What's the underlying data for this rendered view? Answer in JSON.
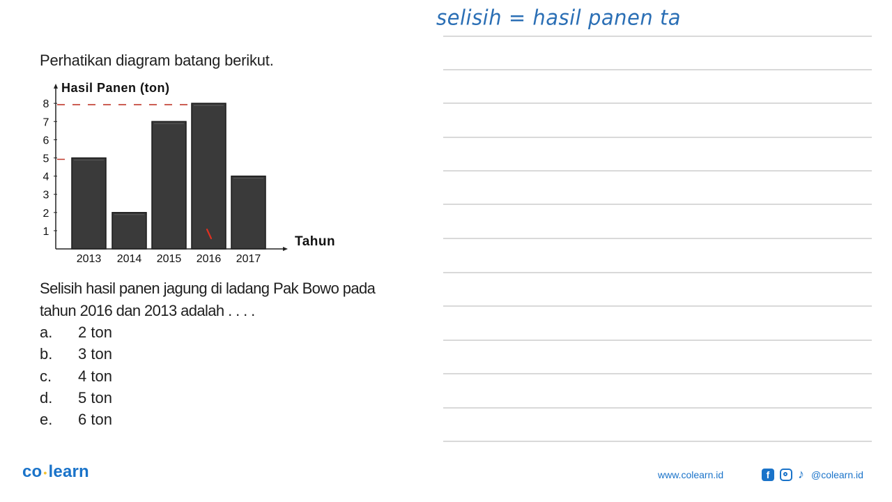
{
  "question": {
    "intro": "Perhatikan diagram batang berikut.",
    "text": "Selisih hasil panen jagung di ladang Pak Bowo pada tahun 2016 dan 2013 adalah . . . .",
    "line1": "Selisih hasil panen jagung di ladang Pak Bowo pada",
    "line2": "tahun 2016 dan 2013 adalah . . . .",
    "options": [
      {
        "letter": "a.",
        "text": "2 ton"
      },
      {
        "letter": "b.",
        "text": "3 ton"
      },
      {
        "letter": "c.",
        "text": "4 ton"
      },
      {
        "letter": "d.",
        "text": "5 ton"
      },
      {
        "letter": "e.",
        "text": "6 ton"
      }
    ]
  },
  "chart_data": {
    "type": "bar",
    "title": "",
    "ylabel": "Hasil Panen (ton)",
    "xlabel": "Tahun",
    "categories": [
      "2013",
      "2014",
      "2015",
      "2016",
      "2017"
    ],
    "values": [
      5,
      2,
      7,
      8,
      4
    ],
    "ylim": [
      0,
      8
    ],
    "yticks": [
      1,
      2,
      3,
      4,
      5,
      6,
      7,
      8
    ],
    "grid": false,
    "bar_color": "#3a3a3a",
    "annotations": [
      {
        "type": "dashed-guide",
        "value": 8,
        "color": "#c0392b",
        "to_category": "2016"
      },
      {
        "type": "dashed-guide",
        "value": 5,
        "color": "#c0392b",
        "to_category": "2013"
      },
      {
        "type": "pen-mark",
        "category": "2016",
        "color": "#e03020"
      }
    ]
  },
  "handwriting": {
    "note": "selisih = hasil panen ta",
    "color": "#2b6fb5"
  },
  "footer": {
    "logo_left": "co",
    "logo_dot": "•",
    "logo_right": "learn",
    "website": "www.colearn.id",
    "facebook_glyph": "f",
    "tiktok_glyph": "♪",
    "handle": "@colearn.id",
    "brand_color": "#1a73c9"
  }
}
